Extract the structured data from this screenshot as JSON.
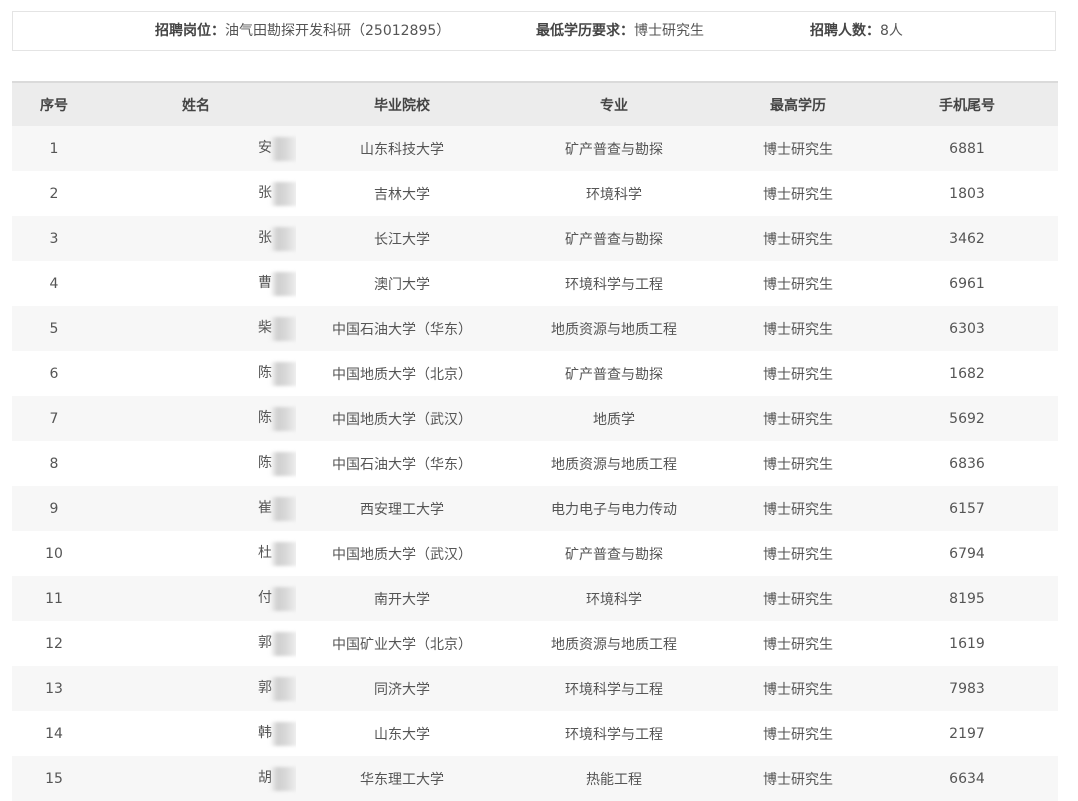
{
  "info": {
    "position_label": "招聘岗位：",
    "position_value": "油气田勘探开发科研（25012895）",
    "edu_label": "最低学历要求：",
    "edu_value": "博士研究生",
    "count_label": "招聘人数：",
    "count_value": "8人"
  },
  "table": {
    "headers": {
      "no": "序号",
      "name": "姓名",
      "school": "毕业院校",
      "major": "专业",
      "edu": "最高学历",
      "phone": "手机尾号"
    },
    "rows": [
      {
        "no": "1",
        "name": "安",
        "school": "山东科技大学",
        "major": "矿产普查与勘探",
        "edu": "博士研究生",
        "phone": "6881"
      },
      {
        "no": "2",
        "name": "张",
        "school": "吉林大学",
        "major": "环境科学",
        "edu": "博士研究生",
        "phone": "1803"
      },
      {
        "no": "3",
        "name": "张",
        "school": "长江大学",
        "major": "矿产普查与勘探",
        "edu": "博士研究生",
        "phone": "3462"
      },
      {
        "no": "4",
        "name": "曹",
        "school": "澳门大学",
        "major": "环境科学与工程",
        "edu": "博士研究生",
        "phone": "6961"
      },
      {
        "no": "5",
        "name": "柴",
        "school": "中国石油大学（华东）",
        "major": "地质资源与地质工程",
        "edu": "博士研究生",
        "phone": "6303"
      },
      {
        "no": "6",
        "name": "陈",
        "school": "中国地质大学（北京）",
        "major": "矿产普查与勘探",
        "edu": "博士研究生",
        "phone": "1682"
      },
      {
        "no": "7",
        "name": "陈",
        "school": "中国地质大学（武汉）",
        "major": "地质学",
        "edu": "博士研究生",
        "phone": "5692"
      },
      {
        "no": "8",
        "name": "陈",
        "school": "中国石油大学（华东）",
        "major": "地质资源与地质工程",
        "edu": "博士研究生",
        "phone": "6836"
      },
      {
        "no": "9",
        "name": "崔",
        "school": "西安理工大学",
        "major": "电力电子与电力传动",
        "edu": "博士研究生",
        "phone": "6157"
      },
      {
        "no": "10",
        "name": "杜",
        "school": "中国地质大学（武汉）",
        "major": "矿产普查与勘探",
        "edu": "博士研究生",
        "phone": "6794"
      },
      {
        "no": "11",
        "name": "付",
        "school": "南开大学",
        "major": "环境科学",
        "edu": "博士研究生",
        "phone": "8195"
      },
      {
        "no": "12",
        "name": "郭",
        "school": "中国矿业大学（北京）",
        "major": "地质资源与地质工程",
        "edu": "博士研究生",
        "phone": "1619"
      },
      {
        "no": "13",
        "name": "郭",
        "school": "同济大学",
        "major": "环境科学与工程",
        "edu": "博士研究生",
        "phone": "7983"
      },
      {
        "no": "14",
        "name": "韩",
        "school": "山东大学",
        "major": "环境科学与工程",
        "edu": "博士研究生",
        "phone": "2197"
      },
      {
        "no": "15",
        "name": "胡",
        "school": "华东理工大学",
        "major": "热能工程",
        "edu": "博士研究生",
        "phone": "6634"
      }
    ]
  }
}
